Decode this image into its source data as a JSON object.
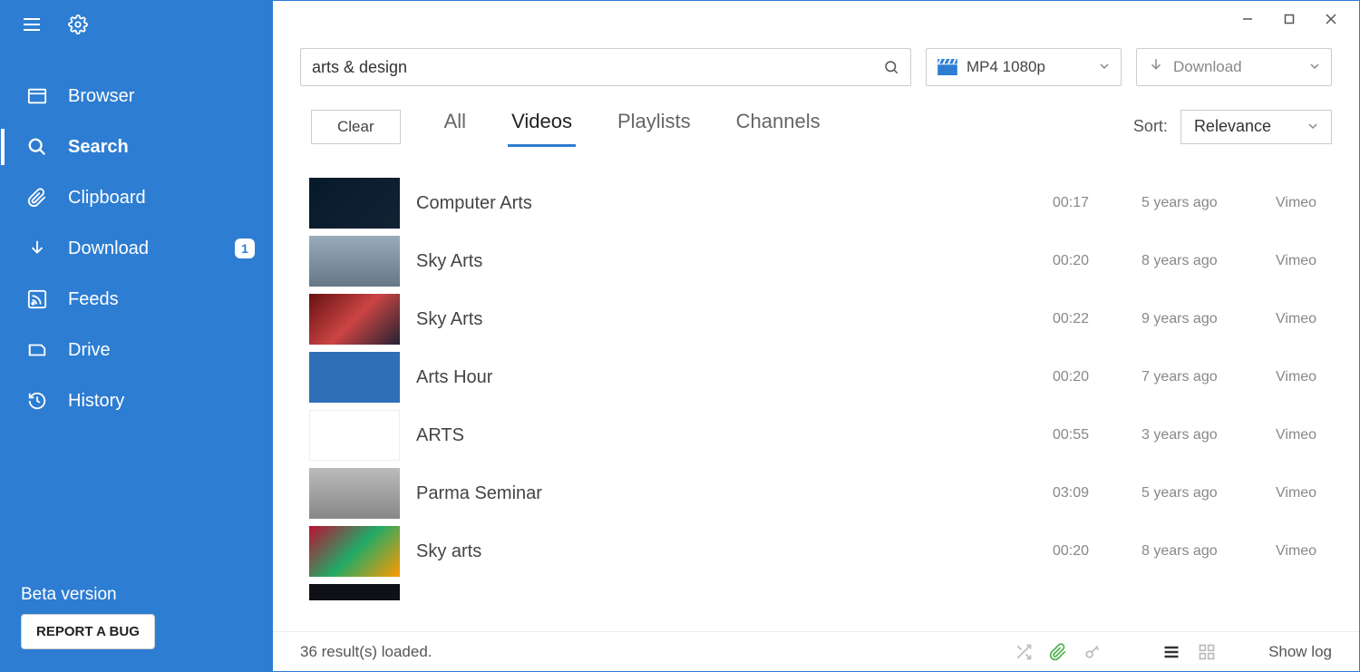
{
  "sidebar": {
    "items": [
      {
        "label": "Browser",
        "icon": "browser"
      },
      {
        "label": "Search",
        "icon": "search",
        "active": true
      },
      {
        "label": "Clipboard",
        "icon": "clipboard"
      },
      {
        "label": "Download",
        "icon": "download",
        "badge": "1"
      },
      {
        "label": "Feeds",
        "icon": "feeds"
      },
      {
        "label": "Drive",
        "icon": "drive"
      },
      {
        "label": "History",
        "icon": "history"
      }
    ],
    "beta_label": "Beta version",
    "bug_button": "REPORT A BUG"
  },
  "toolbar": {
    "search_value": "arts & design",
    "format_label": "MP4 1080p",
    "download_label": "Download"
  },
  "filters": {
    "clear_label": "Clear",
    "tabs": [
      "All",
      "Videos",
      "Playlists",
      "Channels"
    ],
    "active_tab": 1,
    "sort_label": "Sort:",
    "sort_value": "Relevance"
  },
  "results": [
    {
      "title": "Computer Arts",
      "duration": "00:17",
      "age": "5 years ago",
      "source": "Vimeo",
      "thumb": 0
    },
    {
      "title": "Sky Arts",
      "duration": "00:20",
      "age": "8 years ago",
      "source": "Vimeo",
      "thumb": 1
    },
    {
      "title": "Sky Arts",
      "duration": "00:22",
      "age": "9 years ago",
      "source": "Vimeo",
      "thumb": 2
    },
    {
      "title": "Arts Hour",
      "duration": "00:20",
      "age": "7 years ago",
      "source": "Vimeo",
      "thumb": 3
    },
    {
      "title": "ARTS",
      "duration": "00:55",
      "age": "3 years ago",
      "source": "Vimeo",
      "thumb": 4
    },
    {
      "title": "Parma Seminar",
      "duration": "03:09",
      "age": "5 years ago",
      "source": "Vimeo",
      "thumb": 5
    },
    {
      "title": "Sky arts",
      "duration": "00:20",
      "age": "8 years ago",
      "source": "Vimeo",
      "thumb": 6
    }
  ],
  "status": {
    "results_text": "36 result(s) loaded.",
    "show_log": "Show log"
  }
}
